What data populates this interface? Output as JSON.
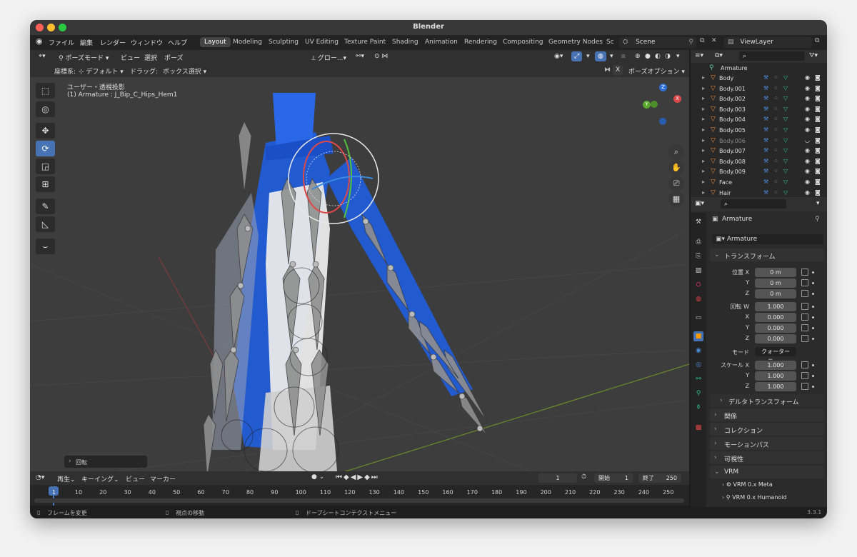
{
  "window": {
    "title": "Blender"
  },
  "menubar": {
    "menus": [
      "ファイル",
      "編集",
      "レンダー",
      "ウィンドウ",
      "ヘルプ"
    ],
    "workspaces": [
      "Layout",
      "Modeling",
      "Sculpting",
      "UV Editing",
      "Texture Paint",
      "Shading",
      "Animation",
      "Rendering",
      "Compositing",
      "Geometry Nodes",
      "Sc"
    ],
    "scene": "Scene",
    "viewlayer": "ViewLayer"
  },
  "viewport": {
    "mode": "ポーズモード",
    "menus": [
      "ビュー",
      "選択",
      "ポーズ"
    ],
    "orientation": "グロー...",
    "coord_label": "座標系:",
    "coord_value": "デフォルト",
    "drag_label": "ドラッグ:",
    "drag_value": "ボックス選択",
    "x_label": "X",
    "pose_options": "ポーズオプション",
    "overlay_title": "ユーザー・透視投影",
    "overlay_sub": "(1) Armature : J_Bip_C_Hips_Hem1",
    "last_op": "回転",
    "gizmo": {
      "x": "X",
      "y": "Y",
      "z": "Z"
    }
  },
  "outliner": {
    "root": "Armature",
    "items": [
      "Body",
      "Body.001",
      "Body.002",
      "Body.003",
      "Body.004",
      "Body.005",
      "Body.006",
      "Body.007",
      "Body.008",
      "Body.009",
      "Face",
      "Hair"
    ]
  },
  "properties": {
    "object_name": "Armature",
    "data_name": "Armature",
    "transform": {
      "title": "トランスフォーム",
      "location_label": "位置 X",
      "location": [
        "0 m",
        "0 m",
        "0 m"
      ],
      "rotation_label": "回転 W",
      "rotation": [
        "1.000",
        "0.000",
        "0.000",
        "0.000"
      ],
      "mode_label": "モード",
      "mode_value": "クォーターニ...",
      "scale_label": "スケール X",
      "scale": [
        "1.000",
        "1.000",
        "1.000"
      ],
      "axis_y": "Y",
      "axis_z": "Z",
      "axis_x": "X",
      "delta": "デルタトランスフォーム"
    },
    "sections": [
      "関係",
      "コレクション",
      "モーションパス",
      "可視性",
      "VRM"
    ],
    "vrm_items": [
      "VRM 0.x Meta",
      "VRM 0.x Humanoid"
    ]
  },
  "timeline": {
    "menus": [
      "再生",
      "キーイング",
      "ビュー",
      "マーカー"
    ],
    "current_frame": "1",
    "start_label": "開始",
    "start": "1",
    "end_label": "終了",
    "end": "250",
    "ticks": [
      "1",
      "10",
      "20",
      "30",
      "40",
      "50",
      "60",
      "70",
      "80",
      "90",
      "100",
      "110",
      "120",
      "130",
      "140",
      "150",
      "160",
      "170",
      "180",
      "190",
      "200",
      "210",
      "220",
      "230",
      "240",
      "250"
    ]
  },
  "statusbar": {
    "hint1": "フレームを変更",
    "hint2": "視点の移動",
    "hint3": "ドープシートコンテクストメニュー",
    "version": "3.3.1"
  },
  "colors": {
    "accent": "#4772b3",
    "mesh_blue": "#1f5de0",
    "light_blue": "#3fa0ff"
  }
}
